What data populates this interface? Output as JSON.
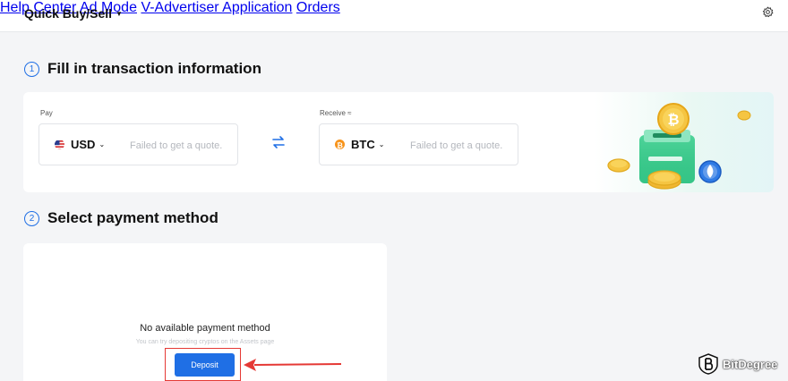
{
  "header": {
    "brand": "Quick Buy/Sell",
    "nav": [
      "Help Center",
      "Ad Mode",
      "V-Advertiser Application",
      "Orders"
    ]
  },
  "step1": {
    "number": "1",
    "title": "Fill in transaction information"
  },
  "pay": {
    "label": "Pay",
    "currency": "USD",
    "quote_placeholder": "Failed to get a quote."
  },
  "receive": {
    "label": "Receive ≈",
    "currency": "BTC",
    "quote_placeholder": "Failed to get a quote."
  },
  "step2": {
    "number": "2",
    "title": "Select payment method"
  },
  "payment": {
    "empty_title": "No available payment method",
    "empty_hint": "You can try depositing cryptos on the Assets page",
    "deposit_label": "Deposit"
  },
  "watermark": {
    "text": "BitDegree"
  },
  "colors": {
    "accent": "#1f6fe5",
    "annotation": "#e53935",
    "btc": "#f7931a"
  },
  "icons": [
    "chevron-down-icon",
    "gear-icon",
    "us-flag-icon",
    "btc-icon",
    "swap-icon",
    "coin-illustration",
    "red-arrow-icon"
  ]
}
